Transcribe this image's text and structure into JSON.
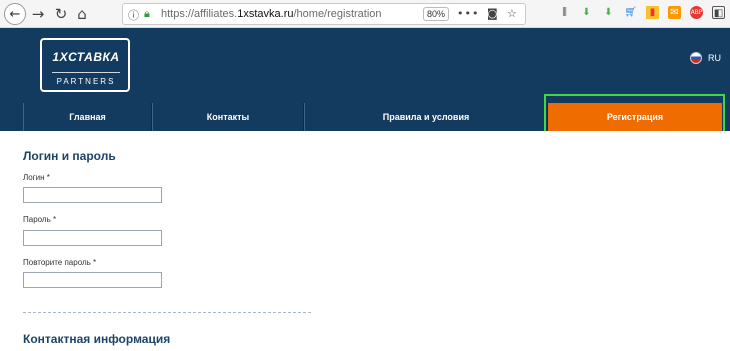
{
  "browser": {
    "url_prefix": "https://affiliates.",
    "url_domain": "1xstavka.ru",
    "url_suffix": "/home/registration",
    "zoom": "80%",
    "more_label": "•••"
  },
  "header": {
    "logo_brand": "1XСТАВКА",
    "logo_sub": "PARTNERS",
    "language": "RU"
  },
  "nav": {
    "items": [
      {
        "label": "Главная"
      },
      {
        "label": "Контакты"
      },
      {
        "label": "Правила и условия"
      },
      {
        "label": "Регистрация"
      }
    ],
    "active": "Регистрация",
    "accent": "#ef6c00"
  },
  "form": {
    "section1_title": "Логин и пароль",
    "login_label": "Логин",
    "password_label": "Пароль",
    "repeat_password_label": "Повторите пароль",
    "required_mark": "*",
    "login_value": "",
    "password_value": "",
    "repeat_password_value": "",
    "section2_title": "Контактная информация"
  },
  "colors": {
    "header_bg": "#133a5f",
    "highlight": "#43d543"
  }
}
